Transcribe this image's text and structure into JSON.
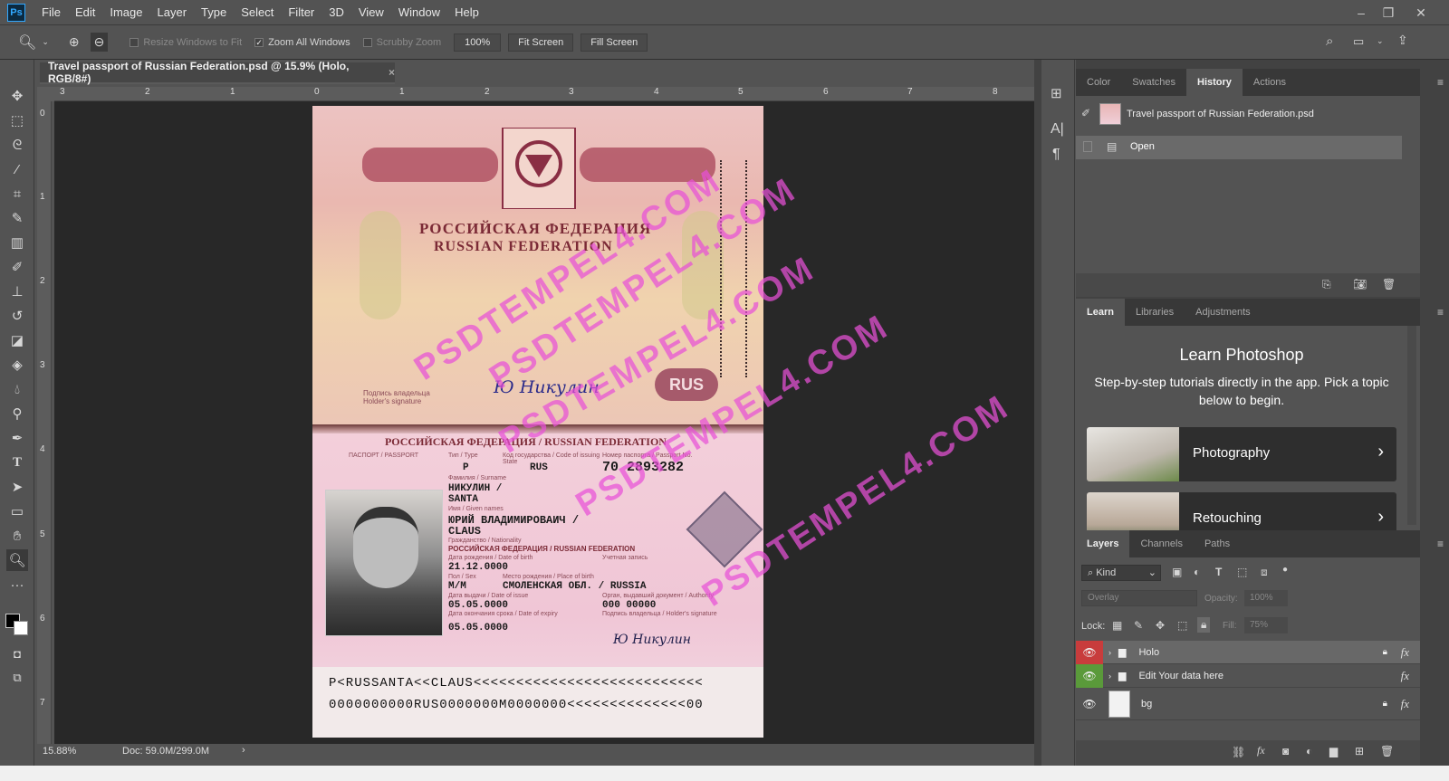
{
  "app": {
    "logo": "Ps"
  },
  "menu": [
    "File",
    "Edit",
    "Image",
    "Layer",
    "Type",
    "Select",
    "Filter",
    "3D",
    "View",
    "Window",
    "Help"
  ],
  "options": {
    "resize_windows": "Resize Windows to Fit",
    "zoom_all": "Zoom All Windows",
    "scrubby": "Scrubby Zoom",
    "zoom_value": "100%",
    "fit_screen": "Fit Screen",
    "fill_screen": "Fill Screen"
  },
  "document": {
    "tab_title": "Travel passport of Russian Federation.psd @ 15.9% (Holo, RGB/8#)",
    "zoom": "15.88%",
    "doc_size": "Doc: 59.0M/299.0M",
    "ruler_h": [
      "3",
      "2",
      "1",
      "0",
      "1",
      "2",
      "3",
      "4",
      "5",
      "6",
      "7",
      "8"
    ],
    "ruler_v": [
      "0",
      "1",
      "2",
      "3",
      "4",
      "5",
      "6",
      "7"
    ]
  },
  "passport": {
    "title_ru": "РОССИЙСКАЯ ФЕДЕРАЦИЯ",
    "title_en": "RUSSIAN FEDERATION",
    "sig_label_ru": "Подпись владельца",
    "sig_label_en": "Holder's signature",
    "signature": "Ю Никулин",
    "rus_badge": "RUS",
    "header": "РОССИЙСКАЯ ФЕДЕРАЦИЯ / RUSSIAN FEDERATION",
    "passport_label": "ПАСПОРТ / PASSPORT",
    "type_label": "Тип / Type",
    "type_value": "P",
    "code_label": "Код государства / Code of issuing State",
    "code_value": "RUS",
    "number_label": "Номер паспорта / Passport No.",
    "number_value": "70 2893282",
    "surname_label": "Фамилия / Surname",
    "surname_value_1": "НИКУЛИН /",
    "surname_value_2": "SANTA",
    "given_label": "Имя / Given names",
    "given_value_1": "ЮРИЙ ВЛАДИМИРОВАИЧ /",
    "given_value_2": "CLAUS",
    "nationality_label": "Гражданство / Nationality",
    "nationality_value": "РОССИЙСКАЯ ФЕДЕРАЦИЯ / RUSSIAN FEDERATION",
    "dob_label": "Дата рождения / Date of birth",
    "dob_value": "21.12.0000",
    "record_label": "Учетная запись",
    "sex_label": "Пол / Sex",
    "sex_value": "М/M",
    "pob_label": "Место рождения / Place of birth",
    "pob_value": "СМОЛЕНСКАЯ ОБЛ. / RUSSIA",
    "issue_label": "Дата выдачи / Date of issue",
    "issue_value": "05.05.0000",
    "authority_label": "Орган, выдавший документ / Authority",
    "authority_value": "000 00000",
    "expiry_label": "Дата окончания срока / Date of expiry",
    "expiry_value": "05.05.0000",
    "holder_sig_label": "Подпись владельца / Holder's signature",
    "signature2": "Ю Никулин",
    "mrz1": "P<RUSSANTA<<CLAUS<<<<<<<<<<<<<<<<<<<<<<<<<<<",
    "mrz2": "0000000000RUS0000000M0000000<<<<<<<<<<<<<<00"
  },
  "watermark": "PSDTEMPEL4.COM",
  "panels": {
    "top_tabs": [
      "Color",
      "Swatches",
      "History",
      "Actions"
    ],
    "history_file": "Travel passport of Russian Federation.psd",
    "history_step": "Open",
    "mid_tabs": [
      "Learn",
      "Libraries",
      "Adjustments"
    ],
    "learn_title": "Learn Photoshop",
    "learn_desc": "Step-by-step tutorials directly in the app. Pick a topic below to begin.",
    "cards": [
      "Photography",
      "Retouching"
    ],
    "layer_tabs": [
      "Layers",
      "Channels",
      "Paths"
    ],
    "kind": "Kind",
    "blend": "Overlay",
    "opacity_label": "Opacity:",
    "opacity": "100%",
    "lock_label": "Lock:",
    "fill_label": "Fill:",
    "fill": "75%",
    "layers": [
      "Holo",
      "Edit Your data here",
      "bg"
    ]
  },
  "colors": {
    "accent": "#31a8ff",
    "watermark": "#e850d7",
    "eye_red": "#c83c3c",
    "eye_green": "#5a9a3a"
  }
}
